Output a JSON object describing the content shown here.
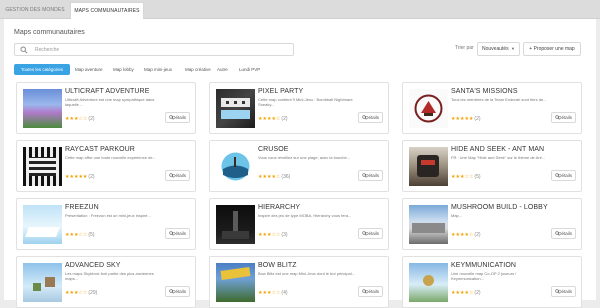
{
  "tabs": [
    "GESTION DES MONDES",
    "MAPS COMMUNAUTAIRES"
  ],
  "page_title": "Maps communautaires",
  "search": {
    "placeholder": "Recherche"
  },
  "sort": {
    "label": "Trier par",
    "selected": "Nouveautés"
  },
  "propose_label": "+ Proposer une map",
  "filters": [
    "Toutes les catégories",
    "Map aventure",
    "Map lobby",
    "Map mini-jeux",
    "Map créative",
    "Autre",
    "Lundi PVP"
  ],
  "details_label": "Détails",
  "icons": {
    "search": "search-icon",
    "details": "magnifier-icon",
    "dropdown": "caret-down-icon"
  },
  "colors": {
    "accent": "#3aa3e3",
    "star": "#f2a200"
  },
  "maps": [
    {
      "title": "ULTICRAFT ADVENTURE",
      "desc": "Ulticraft Adventure est une map sympathique dans laquelle ...",
      "stars": "★★★☆☆",
      "count": "(2)",
      "rating": 3,
      "thumb": "thumb-a"
    },
    {
      "title": "PIXEL PARTY",
      "desc": "Cette map contient 9 Mini-Jeux : Bombball Nightmare Sneaky...",
      "stars": "★★★★☆",
      "count": "(2)",
      "rating": 4,
      "thumb": "thumb-b"
    },
    {
      "title": "SANTA'S MISSIONS",
      "desc": "Tous les membres de la Team Endorah sont fiers de...",
      "stars": "★★★★★",
      "count": "(2)",
      "rating": 5,
      "thumb": "thumb-c"
    },
    {
      "title": "RAYCAST PARKOUR",
      "desc": "Cette map offre une toute nouvelle expérience de...",
      "stars": "★★★★★",
      "count": "(2)",
      "rating": 5,
      "thumb": "thumb-d"
    },
    {
      "title": "CRUSOE",
      "desc": "Vous vous réveillez sur une plage, avec la bouche...",
      "stars": "★★★★☆",
      "count": "(36)",
      "rating": 4,
      "thumb": "thumb-e"
    },
    {
      "title": "HIDE AND SEEK - ANT MAN",
      "desc": "FR : Une Map \"Hide and Seek\" sur le thème de Ant...",
      "stars": "★★★☆☆",
      "count": "(5)",
      "rating": 3,
      "thumb": "thumb-f"
    },
    {
      "title": "FREEZUN",
      "desc": "Présentation : Freezun est un mini-jeux inspiré...",
      "stars": "★★★☆☆",
      "count": "(5)",
      "rating": 3,
      "thumb": "thumb-g"
    },
    {
      "title": "HIERARCHY",
      "desc": "Inspiré des jeu de type MOBA, Hierarchy vous fera...",
      "stars": "★★★☆☆",
      "count": "(3)",
      "rating": 3,
      "thumb": "thumb-h"
    },
    {
      "title": "MUSHROOM BUILD - LOBBY",
      "desc": "Map...",
      "stars": "★★★★☆",
      "count": "(2)",
      "rating": 4,
      "thumb": "thumb-i"
    },
    {
      "title": "ADVANCED SKY",
      "desc": "Les maps Skyblock font partie des plus anciennes maps...",
      "stars": "★★★☆☆",
      "count": "(29)",
      "rating": 3,
      "thumb": "thumb-j"
    },
    {
      "title": "BOW BLITZ",
      "desc": "Bow Blitz est une map Mini-Jeux dont le but principal...",
      "stars": "★★★☆☆",
      "count": "(4)",
      "rating": 3,
      "thumb": "thumb-k"
    },
    {
      "title": "KEYMMUNICATION",
      "desc": "Une nouvelle map Co-OP 2 joueurs ! Keymmunication...",
      "stars": "★★★★☆",
      "count": "(2)",
      "rating": 4,
      "thumb": "thumb-l"
    }
  ]
}
